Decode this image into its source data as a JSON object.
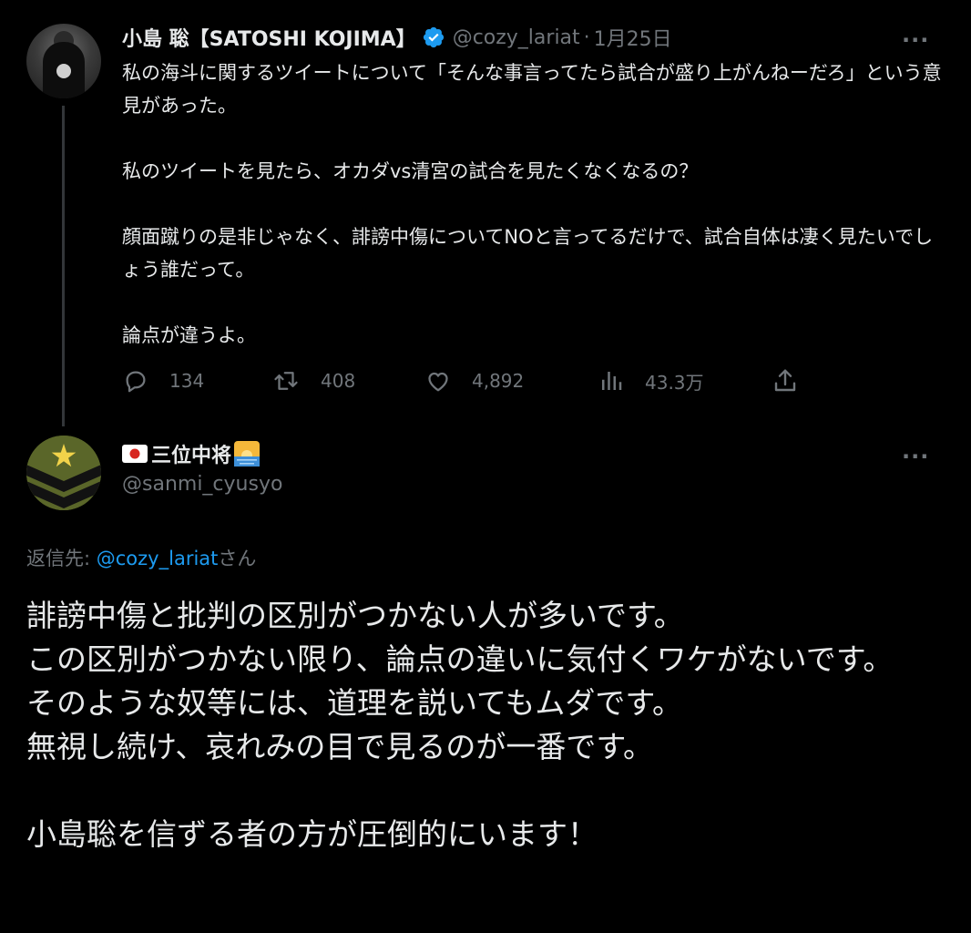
{
  "parent_tweet": {
    "display_name": "小島 聡【SATOSHI KOJIMA】",
    "handle": "@cozy_lariat",
    "separator": "·",
    "date": "1月25日",
    "text": "私の海斗に関するツイートについて「そんな事言ってたら試合が盛り上がんねーだろ」という意見があった。\n\n私のツイートを見たら、オカダvs清宮の試合を見たくなくなるの？\n\n顔面蹴りの是非じゃなく、誹謗中傷についてNOと言ってるだけで、試合自体は凄く見たいでしょう誰だって。\n\n論点が違うよ。",
    "stats": {
      "replies": "134",
      "retweets": "408",
      "likes": "4,892",
      "views": "43.3万"
    },
    "more_label": "···",
    "icons": [
      "verified-badge-icon",
      "reply-icon",
      "retweet-icon",
      "like-icon",
      "views-icon",
      "share-icon",
      "more-icon"
    ]
  },
  "reply_tweet": {
    "display_name": "三位中将",
    "handle": "@sanmi_cyusyo",
    "replying_to_prefix": "返信先: ",
    "replying_to_mention": "@cozy_lariat",
    "replying_to_suffix": "さん",
    "text": "誹謗中傷と批判の区別がつかない人が多いです。\nこの区別がつかない限り、論点の違いに気付くワケがないです。\nそのような奴等には、道理を説いてもムダです。\n無視し続け、哀れみの目で見るのが一番です。\n\n小島聡を信ずる者の方が圧倒的にいます！",
    "more_label": "···",
    "icons": [
      "japan-flag-icon",
      "sunrise-icon",
      "more-icon"
    ]
  },
  "colors": {
    "background": "#000000",
    "text_primary": "#e7e9ea",
    "text_secondary": "#71767b",
    "accent": "#1d9bf0",
    "thread_line": "#333639"
  }
}
